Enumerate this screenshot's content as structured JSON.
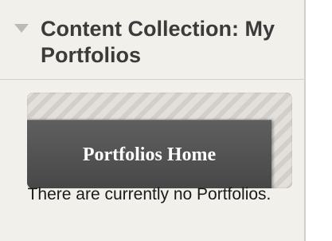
{
  "module": {
    "title": "Content Collection: My Portfolios",
    "collapse_icon": "triangle-down-icon"
  },
  "portfolios": {
    "home_button_label": "Portfolios Home",
    "empty_message": "There are currently no Portfolios."
  },
  "colors": {
    "panel_background": "#f2f0eb",
    "title_text": "#3b3b3b",
    "button_background": "#4f4f4f",
    "button_text": "#ffffff"
  }
}
